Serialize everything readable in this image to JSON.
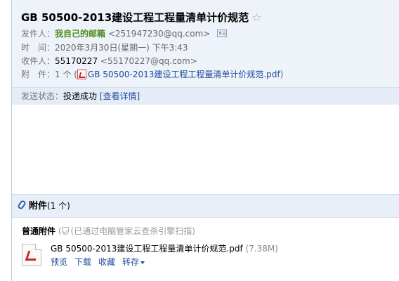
{
  "email": {
    "subject": "GB 50500-2013建设工程工程量清单计价规范",
    "star": "☆",
    "sender_label": "发件人：",
    "sender_name": "我自己的邮箱",
    "sender_addr": "<251947230@qq.com>",
    "time_label": "时　间：",
    "time_value": "2020年3月30日(星期一) 下午3:43",
    "recipient_label": "收件人：",
    "recipient_name": "55170227",
    "recipient_addr": "<55170227@qq.com>",
    "attach_label": "附　件：",
    "attach_count_text": "1 个 (",
    "attach_inline_name": "GB 50500-2013建设工程工程量清单计价规范.pdf",
    "attach_close": ")",
    "status_label": "发送状态：",
    "status_value": "投递成功",
    "status_link": "[查看详情]"
  },
  "attachments": {
    "title": "附件",
    "count": "(1 个)",
    "type_label": "普通附件",
    "scan_text": "(已通过电脑管家云查杀引擎扫描)",
    "files": [
      {
        "name": "GB 50500-2013建设工程工程量清单计价规范.pdf",
        "size": "(7.38M)",
        "actions": [
          "预览",
          "下载",
          "收藏",
          "转存"
        ]
      }
    ]
  },
  "colors": {
    "header_bg": "#eef3fa",
    "link": "#1d4a9a",
    "sender_green": "#4d8c1f"
  }
}
